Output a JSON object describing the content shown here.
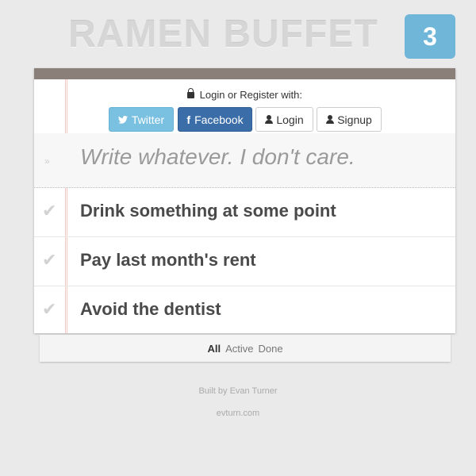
{
  "header": {
    "title": "RAMEN BUFFET",
    "count": "3"
  },
  "login": {
    "label": "Login or Register with:",
    "buttons": {
      "twitter": "Twitter",
      "facebook": "Facebook",
      "login": "Login",
      "signup": "Signup"
    }
  },
  "new_todo": {
    "placeholder": "Write whatever. I don't care."
  },
  "todos": [
    {
      "text": "Drink something at some point",
      "completed": false
    },
    {
      "text": "Pay last month's rent",
      "completed": false
    },
    {
      "text": "Avoid the dentist",
      "completed": false
    }
  ],
  "filters": [
    "All",
    "Active",
    "Done"
  ],
  "selected_filter": "All",
  "credits": {
    "line1": "Built by Evan Turner",
    "line2": "evturn.com"
  },
  "colors": {
    "accent": "#6fb6d9",
    "twitter": "#7ac0e0",
    "facebook": "#3b6ea8",
    "card_top": "#8b7f79"
  },
  "icons": {
    "lock": "lock-icon",
    "twitter": "twitter-icon",
    "facebook": "facebook-icon",
    "user": "user-icon",
    "toggle_all": "chevron-double-down-icon",
    "check": "checkmark-icon"
  }
}
